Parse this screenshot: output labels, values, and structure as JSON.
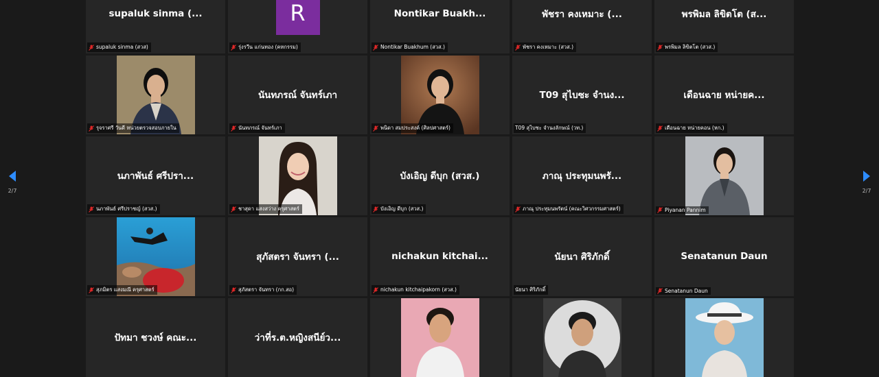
{
  "pager": {
    "left_label": "2/7",
    "right_label": "2/7"
  },
  "tiles": [
    {
      "big": "supaluk sinma (...",
      "label": "supaluk sinma (สวส)",
      "muted": true,
      "kind": "name"
    },
    {
      "big": "R",
      "label": "รุ่งรวีน  แก่นทอง (คหกรรม)",
      "muted": true,
      "kind": "avatar"
    },
    {
      "big": "Nontikar  Buakh...",
      "label": "Nontikar Buakhum  (สวส.)",
      "muted": true,
      "kind": "name"
    },
    {
      "big": "พัชรา  คงเหมาะ (...",
      "label": "พัชรา  คงเหมาะ (สวส.)",
      "muted": true,
      "kind": "name"
    },
    {
      "big": "พรพิมล ลิขิตโต (ส...",
      "label": "พรพิมล ลิขิตโต (สวส.)",
      "muted": true,
      "kind": "name"
    },
    {
      "big": "",
      "label": "รุจราศรี วันดี หน่วยตรวจสอบภายใน",
      "muted": true,
      "kind": "photo",
      "photo": "woman1"
    },
    {
      "big": "นันทภรณ์ จันทร์เภา",
      "label": "นันทภรณ์ จันทร์เภา",
      "muted": true,
      "kind": "name"
    },
    {
      "big": "",
      "label": "พนิดา สมประสงค์ (ศิลปศาสตร์)",
      "muted": true,
      "kind": "photo",
      "photo": "woman2"
    },
    {
      "big": "T09 สุไบซะ จำนง...",
      "label": "T09 สุไบซะ จำนงลักษณ์ (วท.)",
      "muted": false,
      "kind": "name"
    },
    {
      "big": "เดือนฉาย หน่ายค...",
      "label": "เดือนฉาย หน่ายคอน (หก.)",
      "muted": true,
      "kind": "name"
    },
    {
      "big": "นภาพันธ์  ศรีปรา...",
      "label": "นภาพันธ์  ศรีปราชญ์ (สวส.)",
      "muted": true,
      "kind": "name"
    },
    {
      "big": "",
      "label": "ชาสุดา แสงสว่าง ครุศาสตร์",
      "muted": true,
      "kind": "photo",
      "photo": "woman3"
    },
    {
      "big": "บังเอิญ ดีบุก (สวส.)",
      "label": "บังเอิญ ดีบุก (สวส.)",
      "muted": true,
      "kind": "name"
    },
    {
      "big": "ภาณุ ประทุมนพรั...",
      "label": "ภาณุ ประทุมนพรัตน์ (คณะวิศวกรรมศาสตร์)",
      "muted": true,
      "kind": "name"
    },
    {
      "big": "",
      "label": "Piyanan Pannim",
      "muted": true,
      "kind": "photo",
      "photo": "woman4"
    },
    {
      "big": "",
      "label": "สุภมิตร แสงมณี ครุศาสตร์",
      "muted": true,
      "kind": "photo",
      "photo": "diver"
    },
    {
      "big": "สุภัสตรา จันทรา (...",
      "label": "สุภัสตรา จันทรา (กก.สอ)",
      "muted": true,
      "kind": "name"
    },
    {
      "big": "nichakun  kitchai...",
      "label": "nichakun kitchaipakorn (สวส.)",
      "muted": true,
      "kind": "name"
    },
    {
      "big": "นัยนา ศิริภักดิ์",
      "label": "นัยนา ศิริภักดิ์",
      "muted": false,
      "kind": "name"
    },
    {
      "big": "Senatanun Daun",
      "label": "Senatanun Daun",
      "muted": true,
      "kind": "name"
    },
    {
      "big": "ปัทมา ชวงษ์ คณะ...",
      "label": "",
      "muted": false,
      "kind": "name"
    },
    {
      "big": "ว่าที่ร.ต.หญิงสนีย์ว...",
      "label": "",
      "muted": false,
      "kind": "name"
    },
    {
      "big": "",
      "label": "",
      "muted": false,
      "kind": "photo",
      "photo": "man1"
    },
    {
      "big": "",
      "label": "",
      "muted": false,
      "kind": "photo",
      "photo": "man2"
    },
    {
      "big": "",
      "label": "",
      "muted": false,
      "kind": "photo",
      "photo": "hat"
    }
  ]
}
